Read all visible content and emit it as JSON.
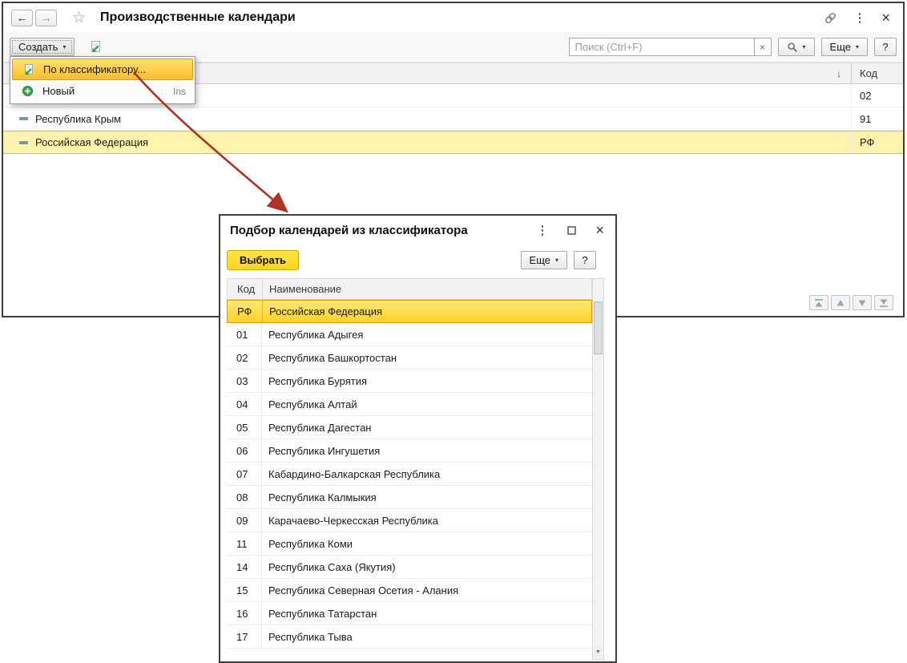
{
  "icons": {
    "back": "←",
    "forward": "→",
    "star": "☆",
    "kebab": "⋮",
    "close": "×",
    "caret": "▾",
    "clear": "×",
    "sort_desc": "↓",
    "scroll_down": "▼"
  },
  "main_window": {
    "title": "Производственные календари",
    "toolbar": {
      "create_label": "Создать",
      "search_placeholder": "Поиск (Ctrl+F)",
      "more_label": "Еще",
      "help_label": "?"
    },
    "create_menu": {
      "items": [
        {
          "label": "По классификатору...",
          "highlighted": true
        },
        {
          "label": "Новый",
          "shortcut": "Ins"
        }
      ]
    },
    "table": {
      "code_header": "Код",
      "rows": [
        {
          "name": "",
          "code": "02"
        },
        {
          "name": "Республика Крым",
          "code": "91"
        },
        {
          "name": "Российская Федерация",
          "code": "РФ",
          "selected": true
        }
      ]
    }
  },
  "dialog": {
    "title": "Подбор календарей из классификатора",
    "toolbar": {
      "select_label": "Выбрать",
      "more_label": "Еще",
      "help_label": "?"
    },
    "table": {
      "code_header": "Код",
      "name_header": "Наименование",
      "rows": [
        {
          "code": "РФ",
          "name": "Российская Федерация",
          "selected": true
        },
        {
          "code": "01",
          "name": "Республика Адыгея"
        },
        {
          "code": "02",
          "name": "Республика Башкортостан"
        },
        {
          "code": "03",
          "name": "Республика Бурятия"
        },
        {
          "code": "04",
          "name": "Республика Алтай"
        },
        {
          "code": "05",
          "name": "Республика Дагестан"
        },
        {
          "code": "06",
          "name": "Республика Ингушетия"
        },
        {
          "code": "07",
          "name": "Кабардино-Балкарская Республика"
        },
        {
          "code": "08",
          "name": "Республика Калмыкия"
        },
        {
          "code": "09",
          "name": "Карачаево-Черкесская Республика"
        },
        {
          "code": "11",
          "name": "Республика Коми"
        },
        {
          "code": "14",
          "name": "Республика Саха (Якутия)"
        },
        {
          "code": "15",
          "name": "Республика Северная Осетия - Алания"
        },
        {
          "code": "16",
          "name": "Республика Татарстан"
        },
        {
          "code": "17",
          "name": "Республика Тыва"
        }
      ]
    }
  },
  "colors": {
    "selection_yellow": "#ffe257",
    "row_highlight": "#fff3ad",
    "menu_highlight": "#fcbe2a",
    "primary_button_yellow": "#ffd41e",
    "arrow_red": "#b23326"
  }
}
